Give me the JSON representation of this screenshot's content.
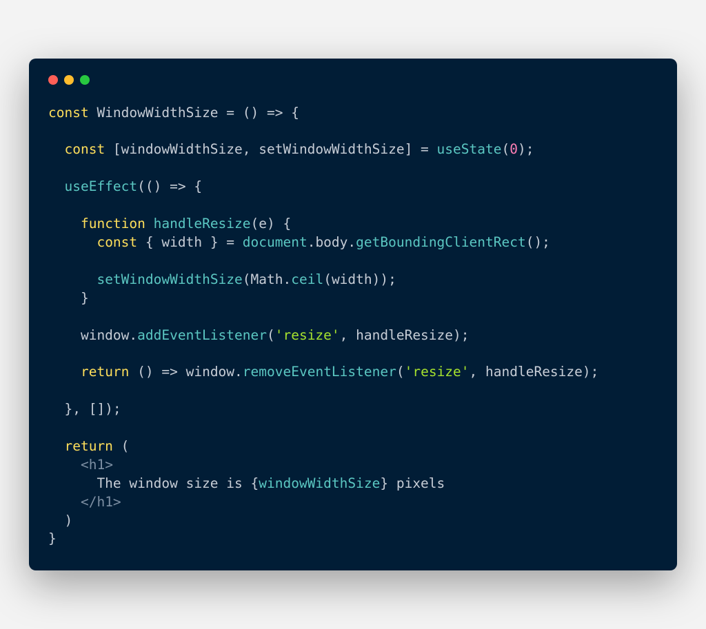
{
  "colors": {
    "bg": "#011d36",
    "close": "#ff5f57",
    "minimize": "#ffbd2e",
    "maximize": "#28c840",
    "keyword": "#ffdf5b",
    "plain": "#c7cdd6",
    "fn": "#5bc7c2",
    "number": "#ff7fb6",
    "string": "#a6e22e",
    "tag": "#7d8fa3"
  },
  "code": {
    "lines": [
      [
        {
          "cls": "keyword",
          "t": "const"
        },
        {
          "cls": "plain",
          "t": " WindowWidthSize = () => {"
        }
      ],
      [],
      [
        {
          "cls": "plain",
          "t": "  "
        },
        {
          "cls": "keyword",
          "t": "const"
        },
        {
          "cls": "plain",
          "t": " [windowWidthSize, setWindowWidthSize] = "
        },
        {
          "cls": "fn",
          "t": "useState"
        },
        {
          "cls": "plain",
          "t": "("
        },
        {
          "cls": "number",
          "t": "0"
        },
        {
          "cls": "plain",
          "t": ");"
        }
      ],
      [],
      [
        {
          "cls": "plain",
          "t": "  "
        },
        {
          "cls": "fn",
          "t": "useEffect"
        },
        {
          "cls": "plain",
          "t": "(() => {"
        }
      ],
      [],
      [
        {
          "cls": "plain",
          "t": "    "
        },
        {
          "cls": "keyword",
          "t": "function"
        },
        {
          "cls": "plain",
          "t": " "
        },
        {
          "cls": "fn",
          "t": "handleResize"
        },
        {
          "cls": "plain",
          "t": "(e) {"
        }
      ],
      [
        {
          "cls": "plain",
          "t": "      "
        },
        {
          "cls": "keyword",
          "t": "const"
        },
        {
          "cls": "plain",
          "t": " { width } = "
        },
        {
          "cls": "fn",
          "t": "document"
        },
        {
          "cls": "plain",
          "t": ".body."
        },
        {
          "cls": "fn",
          "t": "getBoundingClientRect"
        },
        {
          "cls": "plain",
          "t": "();"
        }
      ],
      [],
      [
        {
          "cls": "plain",
          "t": "      "
        },
        {
          "cls": "fn",
          "t": "setWindowWidthSize"
        },
        {
          "cls": "plain",
          "t": "(Math."
        },
        {
          "cls": "fn",
          "t": "ceil"
        },
        {
          "cls": "plain",
          "t": "(width));"
        }
      ],
      [
        {
          "cls": "plain",
          "t": "    }"
        }
      ],
      [],
      [
        {
          "cls": "plain",
          "t": "    window."
        },
        {
          "cls": "fn",
          "t": "addEventListener"
        },
        {
          "cls": "plain",
          "t": "("
        },
        {
          "cls": "string",
          "t": "'resize'"
        },
        {
          "cls": "plain",
          "t": ", handleResize);"
        }
      ],
      [],
      [
        {
          "cls": "plain",
          "t": "    "
        },
        {
          "cls": "keyword",
          "t": "return"
        },
        {
          "cls": "plain",
          "t": " () => window."
        },
        {
          "cls": "fn",
          "t": "removeEventListener"
        },
        {
          "cls": "plain",
          "t": "("
        },
        {
          "cls": "string",
          "t": "'resize'"
        },
        {
          "cls": "plain",
          "t": ", handleResize);"
        }
      ],
      [],
      [
        {
          "cls": "plain",
          "t": "  }, []);"
        }
      ],
      [],
      [
        {
          "cls": "plain",
          "t": "  "
        },
        {
          "cls": "keyword",
          "t": "return"
        },
        {
          "cls": "plain",
          "t": " ("
        }
      ],
      [
        {
          "cls": "plain",
          "t": "    "
        },
        {
          "cls": "tag",
          "t": "<h1>"
        }
      ],
      [
        {
          "cls": "plain",
          "t": "      The window size is {"
        },
        {
          "cls": "fn",
          "t": "windowWidthSize"
        },
        {
          "cls": "plain",
          "t": "} pixels"
        }
      ],
      [
        {
          "cls": "plain",
          "t": "    "
        },
        {
          "cls": "tag",
          "t": "</h1>"
        }
      ],
      [
        {
          "cls": "plain",
          "t": "  )"
        }
      ],
      [
        {
          "cls": "plain",
          "t": "}"
        }
      ]
    ]
  }
}
